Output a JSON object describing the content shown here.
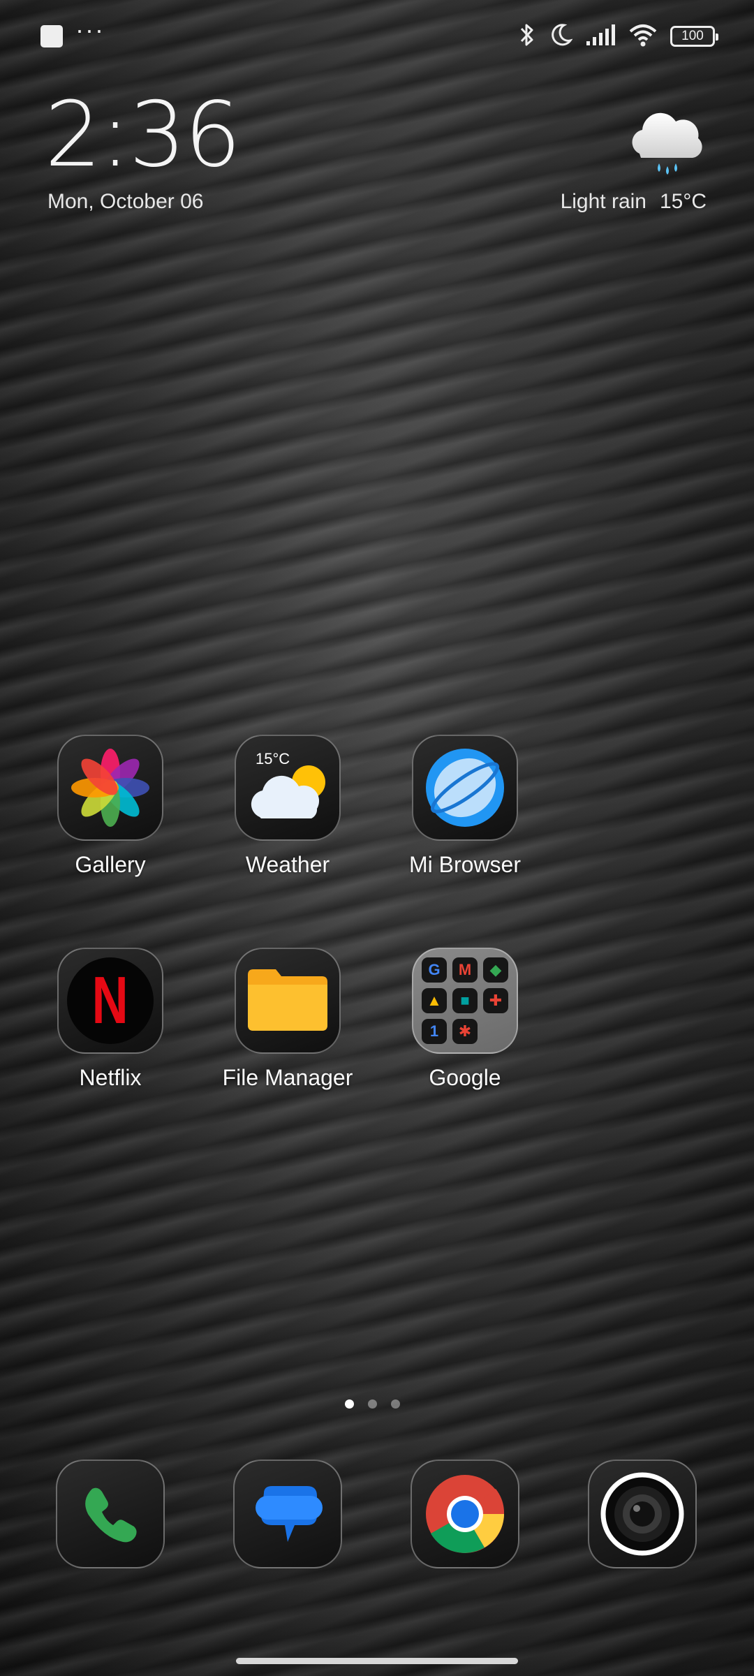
{
  "status_bar": {
    "overflow_indicator": "···",
    "battery_level": "100",
    "icons": [
      "bluetooth-icon",
      "moon-icon",
      "signal-icon",
      "wifi-icon",
      "battery-icon"
    ]
  },
  "clock_widget": {
    "time": "2:36",
    "date": "Mon, October 06"
  },
  "weather_widget": {
    "condition": "Light rain",
    "temperature": "15°C",
    "icon": "rain-cloud-icon"
  },
  "apps": [
    {
      "label": "Gallery",
      "icon": "gallery-icon"
    },
    {
      "label": "Weather",
      "icon": "weather-icon",
      "badge": "15°C"
    },
    {
      "label": "Mi Browser",
      "icon": "mi-browser-icon"
    },
    {
      "label": "Netflix",
      "icon": "netflix-icon",
      "glyph": "N"
    },
    {
      "label": "File Manager",
      "icon": "folder-icon"
    },
    {
      "label": "Google",
      "icon": "google-folder-icon"
    }
  ],
  "google_folder": {
    "mini_glyphs": [
      "G",
      "M",
      "◆",
      "▲",
      "■",
      "✚",
      "1",
      "✱",
      ""
    ]
  },
  "page_indicator": {
    "current": 1,
    "total": 3
  },
  "dock": [
    {
      "icon": "phone-icon"
    },
    {
      "icon": "messages-icon"
    },
    {
      "icon": "chrome-icon"
    },
    {
      "icon": "camera-icon"
    }
  ],
  "colors": {
    "netflix_red": "#E50914",
    "folder_yellow": "#FBB526",
    "phone_green": "#34A853",
    "messages_blue": "#1A73E8",
    "browser_blue": "#2196F3"
  }
}
